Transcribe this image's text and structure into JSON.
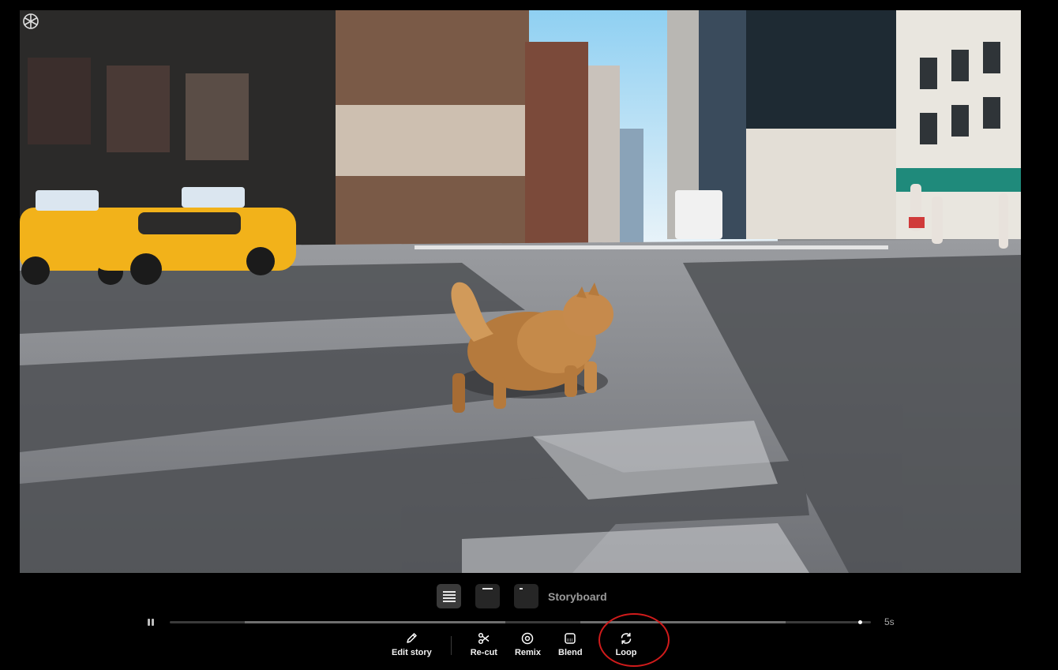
{
  "viewer": {
    "storyboard_label": "Storyboard",
    "duration": "5s",
    "progress": 0.985,
    "view_modes": [
      "list-view",
      "single-frame",
      "frame-start"
    ]
  },
  "toolbar": {
    "edit_story": "Edit story",
    "recut": "Re-cut",
    "remix": "Remix",
    "blend": "Blend",
    "loop": "Loop"
  },
  "colors": {
    "background": "#000000",
    "highlight_ring": "#d01b1b",
    "taxi_yellow": "#f2b21a"
  },
  "icons": [
    "pencil-icon",
    "scissors-icon",
    "remix-icon",
    "blend-icon",
    "loop-icon",
    "pause-icon",
    "watermark-logo-icon"
  ]
}
